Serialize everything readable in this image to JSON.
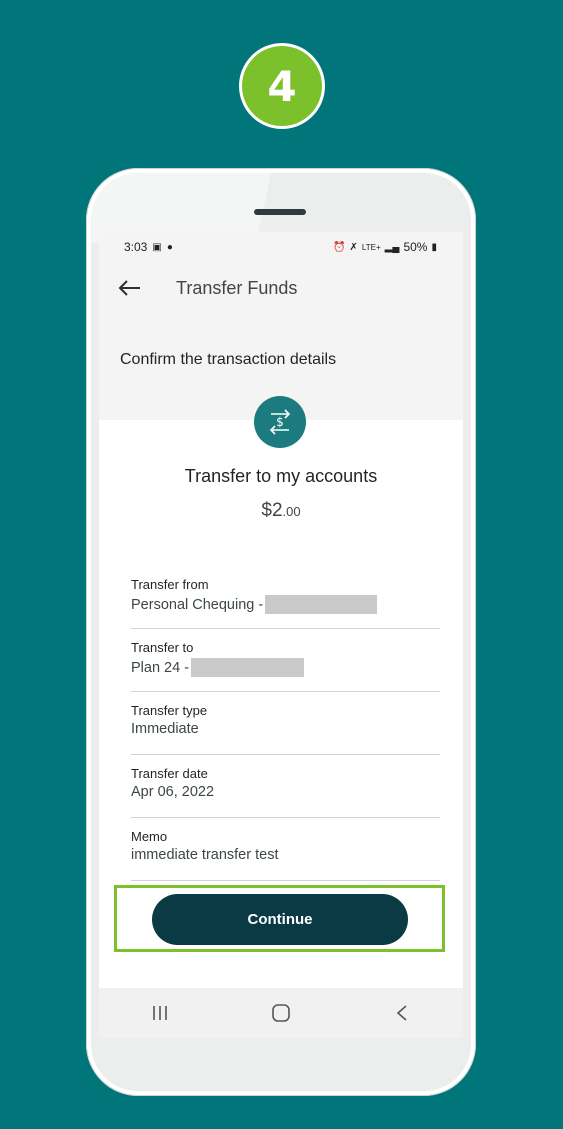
{
  "step": {
    "number": "4"
  },
  "status_bar": {
    "time": "3:03",
    "battery": "50%",
    "network": "LTE+"
  },
  "appbar": {
    "title": "Transfer Funds"
  },
  "confirm": {
    "heading": "Confirm the transaction details"
  },
  "card": {
    "title": "Transfer to my accounts",
    "amount_main": "$2",
    "amount_cents": ".00"
  },
  "details": [
    {
      "label": "Transfer from",
      "value": "Personal Chequing -"
    },
    {
      "label": "Transfer to",
      "value": "Plan 24 -"
    },
    {
      "label": "Transfer type",
      "value": "Immediate"
    },
    {
      "label": "Transfer date",
      "value": "Apr 06, 2022"
    },
    {
      "label": "Memo",
      "value": "immediate transfer test"
    }
  ],
  "actions": {
    "continue_label": "Continue"
  },
  "colors": {
    "background": "#00767b",
    "accent_green": "#7cc12b",
    "button_dark": "#0a3a44",
    "icon_teal": "#1b7b7e"
  },
  "icons": [
    "back-arrow-icon",
    "transfer-dollar-icon",
    "recents-icon",
    "home-icon",
    "back-icon"
  ]
}
